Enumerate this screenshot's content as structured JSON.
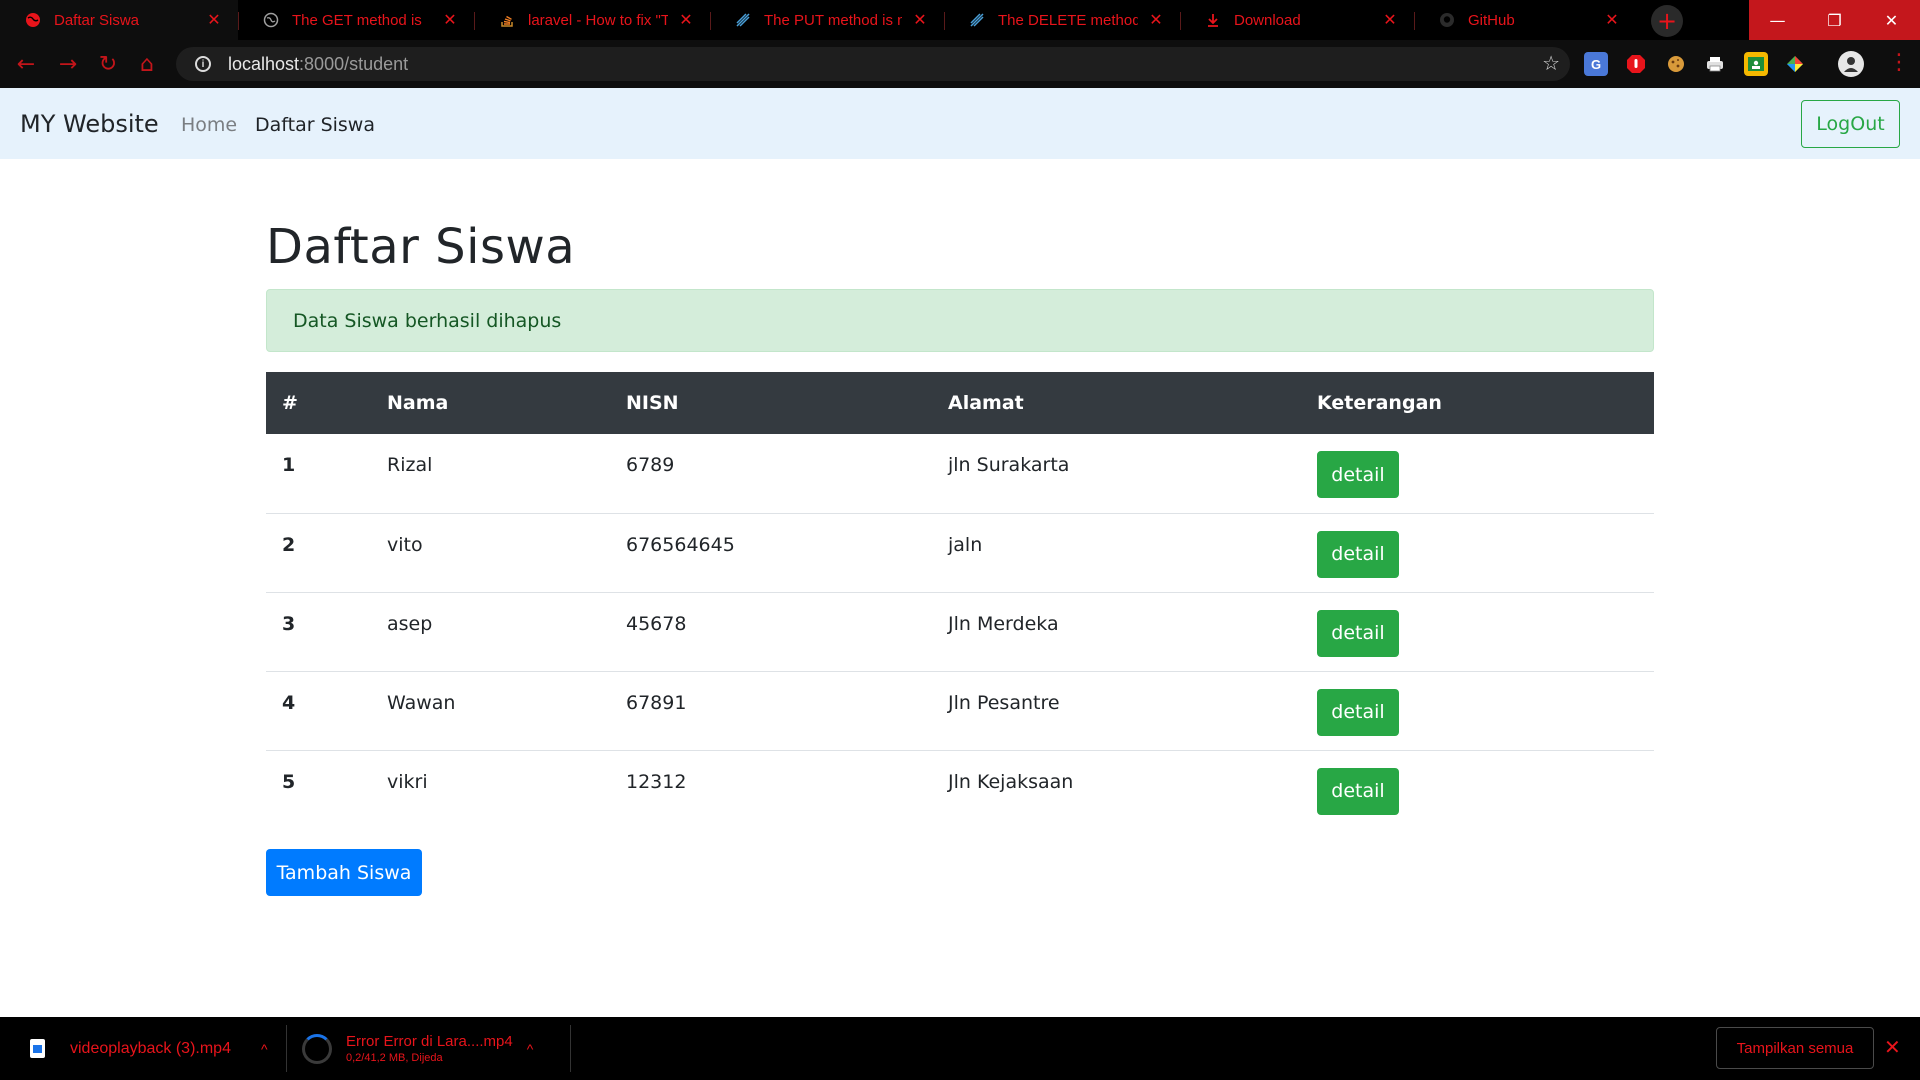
{
  "browser": {
    "tabs": [
      {
        "title": "Daftar Siswa",
        "icon": "globe-icon",
        "active": true
      },
      {
        "title": "The GET method is",
        "icon": "globe-icon"
      },
      {
        "title": "laravel - How to fix \"Th",
        "icon": "stackoverflow-icon"
      },
      {
        "title": "The PUT method is not",
        "icon": "laracasts-icon"
      },
      {
        "title": "The DELETE method is",
        "icon": "laracasts-icon"
      },
      {
        "title": "Download",
        "icon": "download-icon"
      },
      {
        "title": "GitHub",
        "icon": "github-icon"
      }
    ],
    "new_tab": "+",
    "window_controls": {
      "minimize": "—",
      "restore": "❐",
      "close": "✕"
    },
    "nav": {
      "back": "←",
      "forward": "→",
      "reload": "↻",
      "home": "⌂"
    },
    "address": {
      "host": "localhost",
      "path": ":8000/student"
    },
    "bookmark_star": "☆",
    "extensions": [
      "google-translate-icon",
      "adblock-icon",
      "cookie-icon",
      "printer-icon",
      "classroom-icon",
      "colorful-extension-icon"
    ],
    "profile_icon": "profile-icon",
    "menu": "⋮"
  },
  "site": {
    "brand": "MY Website",
    "nav": {
      "home": "Home",
      "daftar": "Daftar Siswa"
    },
    "logout": "LogOut"
  },
  "main": {
    "title": "Daftar Siswa",
    "alert": "Data Siswa berhasil dihapus",
    "table": {
      "headers": [
        "#",
        "Nama",
        "NISN",
        "Alamat",
        "Keterangan"
      ],
      "rows": [
        {
          "no": "1",
          "nama": "Rizal",
          "nisn": "6789",
          "alamat": "jln Surakarta",
          "action": "detail"
        },
        {
          "no": "2",
          "nama": "vito",
          "nisn": "676564645",
          "alamat": "jaln",
          "action": "detail"
        },
        {
          "no": "3",
          "nama": "asep",
          "nisn": "45678",
          "alamat": "Jln Merdeka",
          "action": "detail"
        },
        {
          "no": "4",
          "nama": "Wawan",
          "nisn": "67891",
          "alamat": "Jln Pesantre",
          "action": "detail"
        },
        {
          "no": "5",
          "nama": "vikri",
          "nisn": "12312",
          "alamat": "Jln Kejaksaan",
          "action": "detail"
        }
      ]
    },
    "add_button": "Tambah Siswa"
  },
  "downloads": {
    "items": [
      {
        "name": "videoplayback (3).mp4"
      },
      {
        "name": "Error Error di Lara....mp4",
        "status": "0,2/41,2 MB, Dijeda"
      }
    ],
    "show_all": "Tampilkan semua",
    "close": "✕",
    "caret": "^"
  },
  "colors": {
    "chrome_bg": "#000000",
    "chrome_accent": "#e8141b",
    "navbar_bg": "#e6f2fc",
    "table_header_bg": "#343a40",
    "success": "#28a745",
    "primary": "#007bff",
    "alert_bg": "#d4edda"
  }
}
